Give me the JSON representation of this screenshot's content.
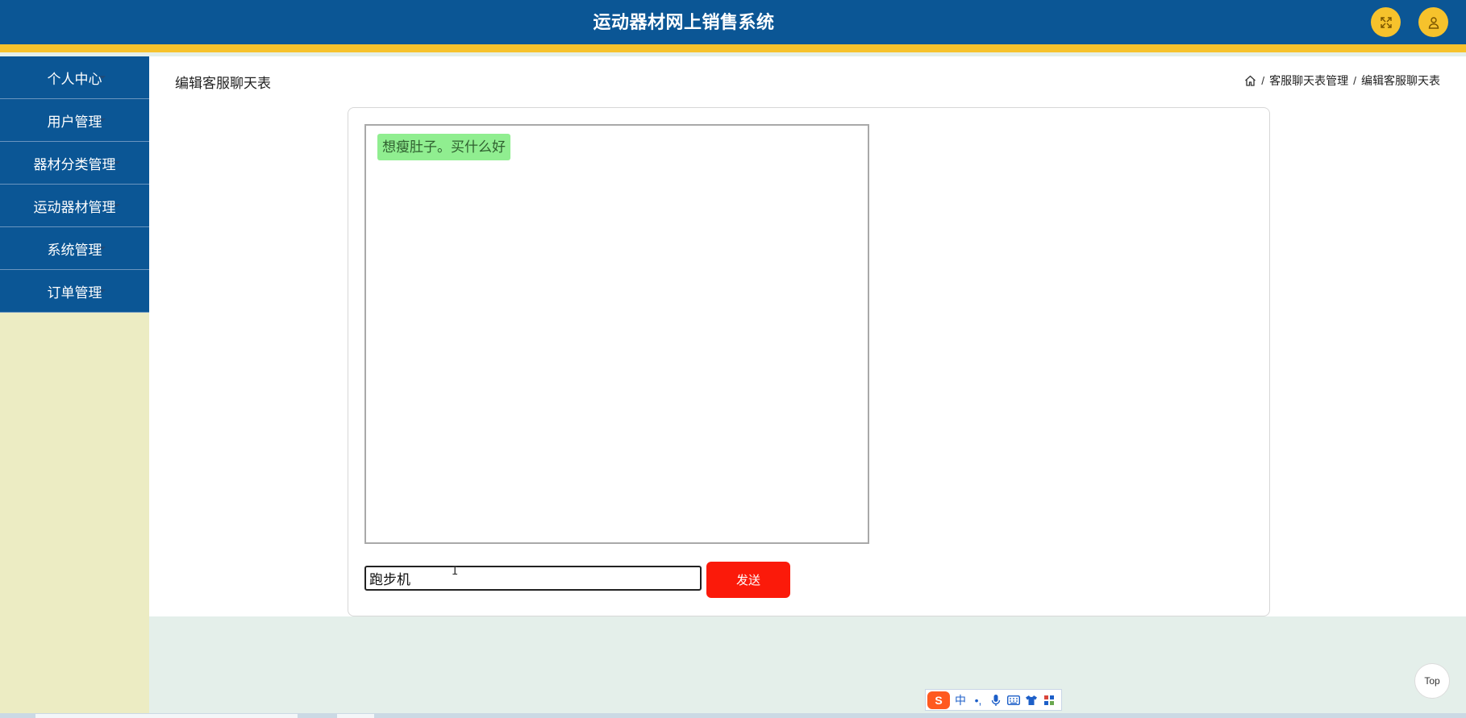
{
  "header": {
    "title": "运动器材网上销售系统",
    "fullscreen_icon": "fullscreen-icon",
    "user_icon": "user-icon"
  },
  "sidebar": {
    "items": [
      {
        "label": "个人中心"
      },
      {
        "label": "用户管理"
      },
      {
        "label": "器材分类管理"
      },
      {
        "label": "运动器材管理"
      },
      {
        "label": "系统管理"
      },
      {
        "label": "订单管理"
      }
    ]
  },
  "page": {
    "title": "编辑客服聊天表",
    "breadcrumb": {
      "home_icon": "home-icon",
      "items": [
        "客服聊天表管理",
        "编辑客服聊天表"
      ],
      "separator": "/"
    }
  },
  "chat": {
    "messages": [
      {
        "text": "想瘦肚子。买什么好"
      }
    ],
    "input_value": "跑步机",
    "send_label": "发送"
  },
  "floating": {
    "top_label": "Top"
  },
  "ime": {
    "logo": "S",
    "mode": "中",
    "punct": "•,",
    "mic_icon": "microphone-icon",
    "keyboard_icon": "keyboard-icon",
    "skin_icon": "shirt-icon",
    "tools_icon": "grid-icon"
  },
  "colors": {
    "header_bg": "#0b5695",
    "accent": "#f6c22c",
    "sidebar_bg": "#ececc3",
    "send_button": "#fb1a0a",
    "bubble": "#90ee90"
  }
}
